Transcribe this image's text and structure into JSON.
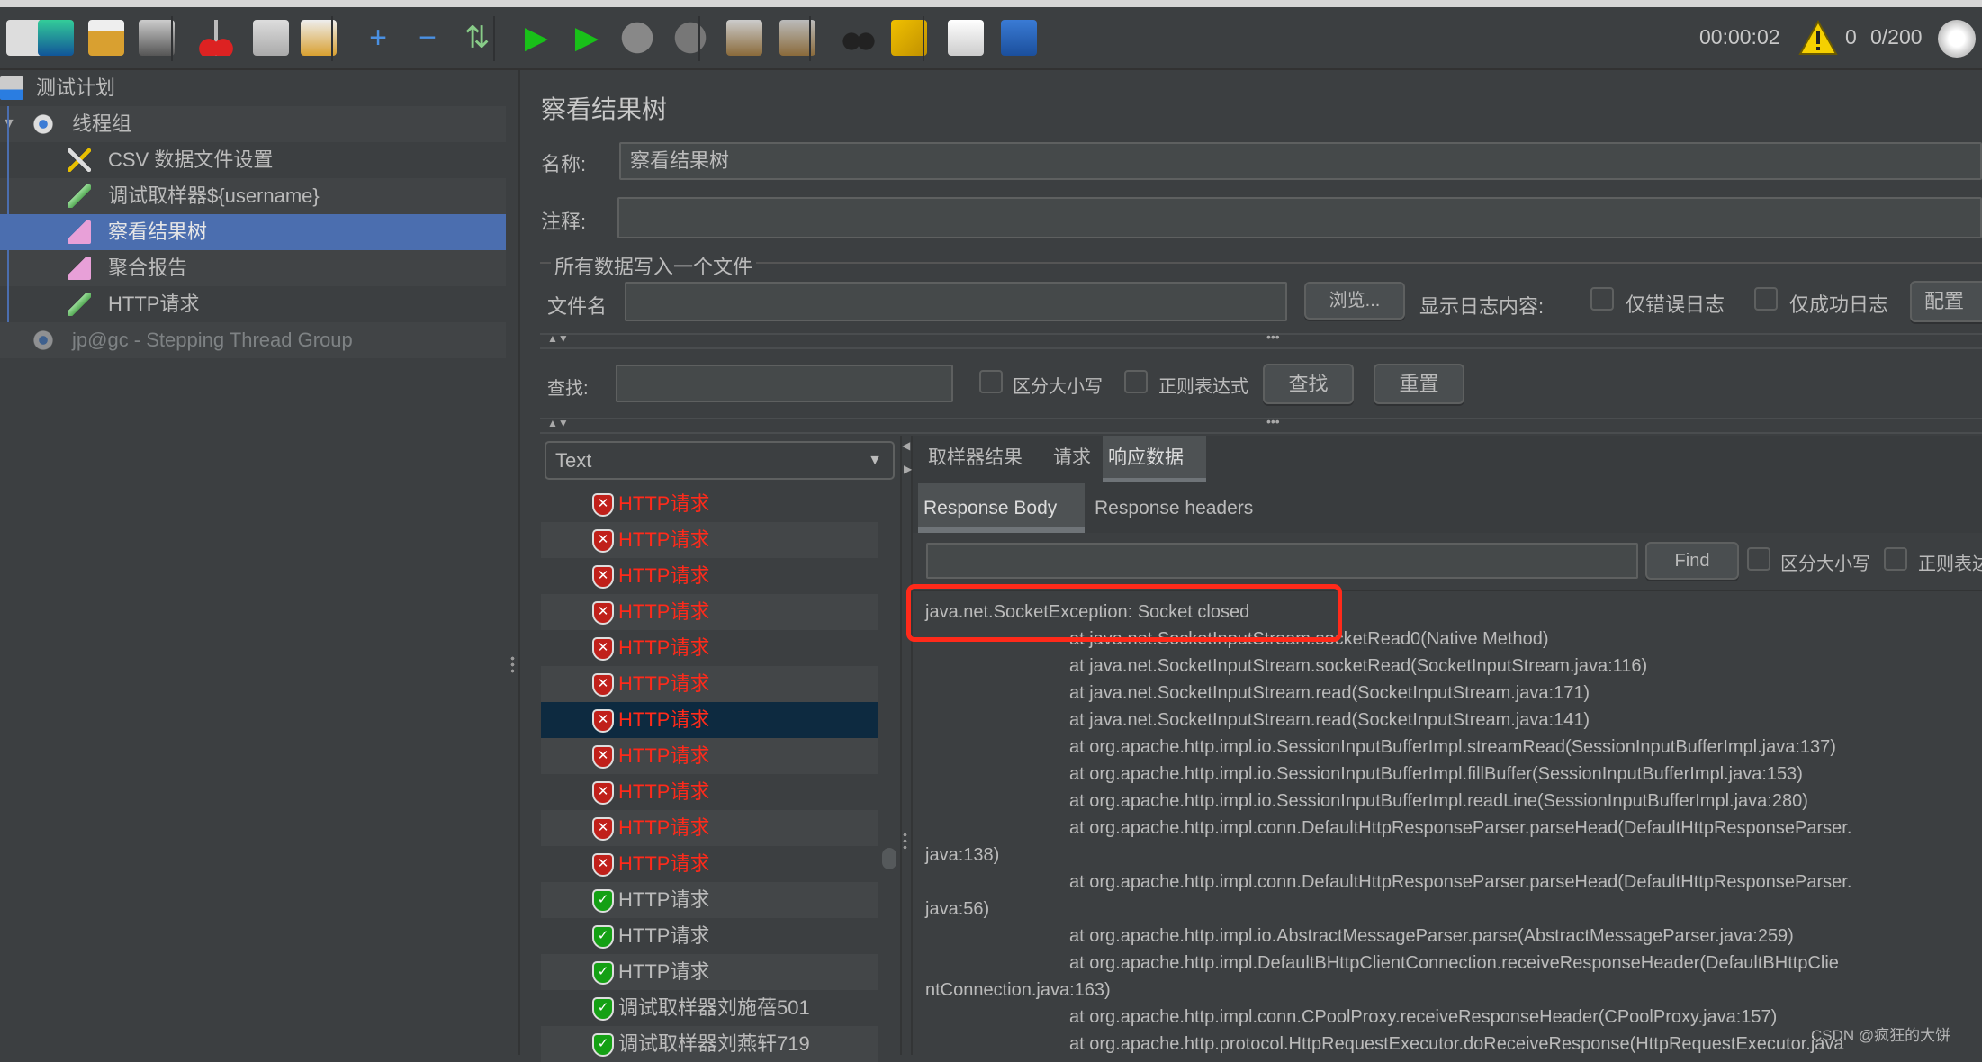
{
  "toolbar": {
    "icons": [
      "new-plan-icon",
      "templates-icon",
      "open-icon",
      "save-icon",
      "cut-icon",
      "copy-icon",
      "paste-icon",
      "expand-icon",
      "collapse-icon",
      "toggle-icon",
      "start-icon",
      "start-no-pause-icon",
      "stop-icon",
      "shutdown-icon",
      "clear-icon",
      "clear-all-icon",
      "search-icon",
      "reset-search-icon",
      "function-helper-icon",
      "help-icon"
    ],
    "elapsed_time": "00:00:02",
    "warning_count": "0",
    "threads": "0/200"
  },
  "tree": {
    "items": [
      {
        "label": "测试计划",
        "icon": "test-plan-icon"
      },
      {
        "label": "线程组",
        "icon": "thread-group-gear-icon"
      },
      {
        "label": "CSV 数据文件设置",
        "icon": "csv-config-icon"
      },
      {
        "label": "调试取样器${username}",
        "icon": "sampler-pipette-icon"
      },
      {
        "label": "察看结果树",
        "icon": "listener-icon",
        "selected": true
      },
      {
        "label": "聚合报告",
        "icon": "listener-icon"
      },
      {
        "label": "HTTP请求",
        "icon": "sampler-pipette-icon"
      },
      {
        "label": "jp@gc - Stepping Thread Group",
        "icon": "thread-group-gear-icon",
        "disabled": true
      }
    ]
  },
  "panel": {
    "title": "察看结果树",
    "name_label": "名称:",
    "name_value": "察看结果树",
    "comment_label": "注释:",
    "comment_value": "",
    "file_section": "所有数据写入一个文件",
    "filename_label": "文件名",
    "filename_value": "",
    "browse_button": "浏览...",
    "log_label": "显示日志内容:",
    "errors_only": "仅错误日志",
    "success_only": "仅成功日志",
    "configure_button": "配置",
    "search_label": "查找:",
    "search_value": "",
    "case_sensitive": "区分大小写",
    "regex": "正则表达式",
    "find_button": "查找",
    "reset_button": "重置"
  },
  "results": {
    "renderer": "Text",
    "rows": [
      {
        "label": "HTTP请求",
        "status": "error"
      },
      {
        "label": "HTTP请求",
        "status": "error"
      },
      {
        "label": "HTTP请求",
        "status": "error"
      },
      {
        "label": "HTTP请求",
        "status": "error"
      },
      {
        "label": "HTTP请求",
        "status": "error"
      },
      {
        "label": "HTTP请求",
        "status": "error"
      },
      {
        "label": "HTTP请求",
        "status": "error",
        "selected": true
      },
      {
        "label": "HTTP请求",
        "status": "error"
      },
      {
        "label": "HTTP请求",
        "status": "error"
      },
      {
        "label": "HTTP请求",
        "status": "error"
      },
      {
        "label": "HTTP请求",
        "status": "error"
      },
      {
        "label": "HTTP请求",
        "status": "success"
      },
      {
        "label": "HTTP请求",
        "status": "success"
      },
      {
        "label": "HTTP请求",
        "status": "success"
      },
      {
        "label": "调试取样器刘施蓓501",
        "status": "success"
      },
      {
        "label": "调试取样器刘燕轩719",
        "status": "success"
      }
    ],
    "colors": {
      "error": "#ff2a1a",
      "success": "#bbbbbb",
      "selected": "#0d2a40"
    }
  },
  "detail": {
    "tabs": [
      "取样器结果",
      "请求",
      "响应数据"
    ],
    "active_tab": "响应数据",
    "subtabs": [
      "Response Body",
      "Response headers"
    ],
    "active_subtab": "Response Body",
    "find_value": "",
    "find_button": "Find",
    "case_sensitive": "区分大小写",
    "regex": "正则表达",
    "body_lines": [
      "java.net.SocketException: Socket closed",
      "\tat java.net.SocketInputStream.socketRead0(Native Method)",
      "\tat java.net.SocketInputStream.socketRead(SocketInputStream.java:116)",
      "\tat java.net.SocketInputStream.read(SocketInputStream.java:171)",
      "\tat java.net.SocketInputStream.read(SocketInputStream.java:141)",
      "\tat org.apache.http.impl.io.SessionInputBufferImpl.streamRead(SessionInputBufferImpl.java:137)",
      "\tat org.apache.http.impl.io.SessionInputBufferImpl.fillBuffer(SessionInputBufferImpl.java:153)",
      "\tat org.apache.http.impl.io.SessionInputBufferImpl.readLine(SessionInputBufferImpl.java:280)",
      "\tat org.apache.http.impl.conn.DefaultHttpResponseParser.parseHead(DefaultHttpResponseParser.",
      "java:138)",
      "\tat org.apache.http.impl.conn.DefaultHttpResponseParser.parseHead(DefaultHttpResponseParser.",
      "java:56)",
      "\tat org.apache.http.impl.io.AbstractMessageParser.parse(AbstractMessageParser.java:259)",
      "\tat org.apache.http.impl.DefaultBHttpClientConnection.receiveResponseHeader(DefaultBHttpClie",
      "ntConnection.java:163)",
      "\tat org.apache.http.impl.conn.CPoolProxy.receiveResponseHeader(CPoolProxy.java:157)",
      "\tat org.apache.http.protocol.HttpRequestExecutor.doReceiveResponse(HttpRequestExecutor.java"
    ],
    "highlight_color": "#ff2a1a"
  },
  "watermark": "CSDN @疯狂的大饼"
}
